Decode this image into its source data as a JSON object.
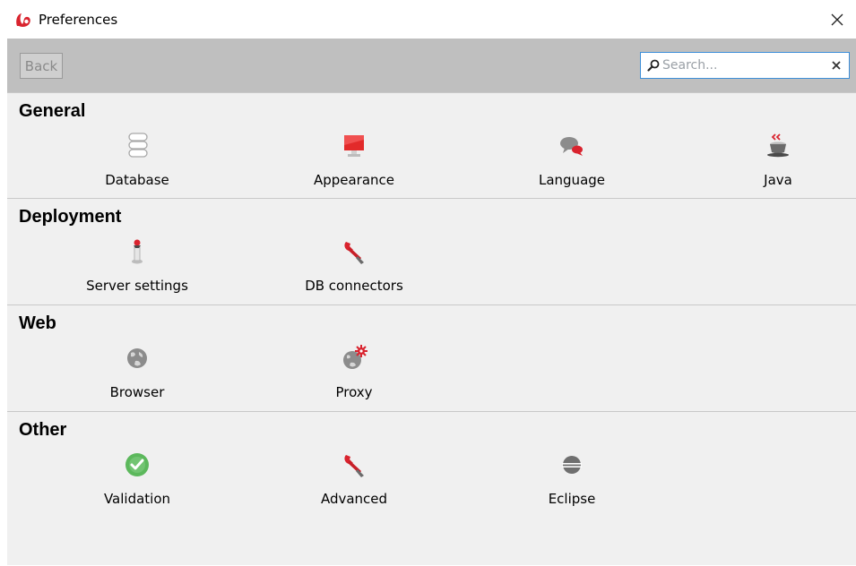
{
  "window": {
    "title": "Preferences",
    "app_icon": "bonita-logo-icon",
    "close_icon": "close-icon"
  },
  "toolbar": {
    "back_label": "Back",
    "search": {
      "placeholder": "Search...",
      "value": "",
      "icon": "search-icon",
      "clear_icon": "clear-icon"
    }
  },
  "sections": [
    {
      "title": "General",
      "items": [
        {
          "label": "Database",
          "icon": "database-icon"
        },
        {
          "label": "Appearance",
          "icon": "appearance-monitor-icon"
        },
        {
          "label": "Language",
          "icon": "language-speech-bubble-icon"
        },
        {
          "label": "Java",
          "icon": "java-coffee-cup-icon"
        }
      ]
    },
    {
      "title": "Deployment",
      "items": [
        {
          "label": "Server settings",
          "icon": "server-settings-icon"
        },
        {
          "label": "DB connectors",
          "icon": "db-connectors-wrench-icon"
        }
      ]
    },
    {
      "title": "Web",
      "items": [
        {
          "label": "Browser",
          "icon": "browser-globe-icon"
        },
        {
          "label": "Proxy",
          "icon": "proxy-globe-gear-icon"
        }
      ]
    },
    {
      "title": "Other",
      "items": [
        {
          "label": "Validation",
          "icon": "validation-check-icon"
        },
        {
          "label": "Advanced",
          "icon": "advanced-wrench-icon"
        },
        {
          "label": "Eclipse",
          "icon": "eclipse-icon"
        }
      ]
    }
  ],
  "colors": {
    "accent_red": "#d9232e",
    "toolbar_gray": "#bfbfbf",
    "panel_gray": "#f0f0f0",
    "search_border": "#3d8ed8",
    "validation_green": "#5cb85c"
  }
}
